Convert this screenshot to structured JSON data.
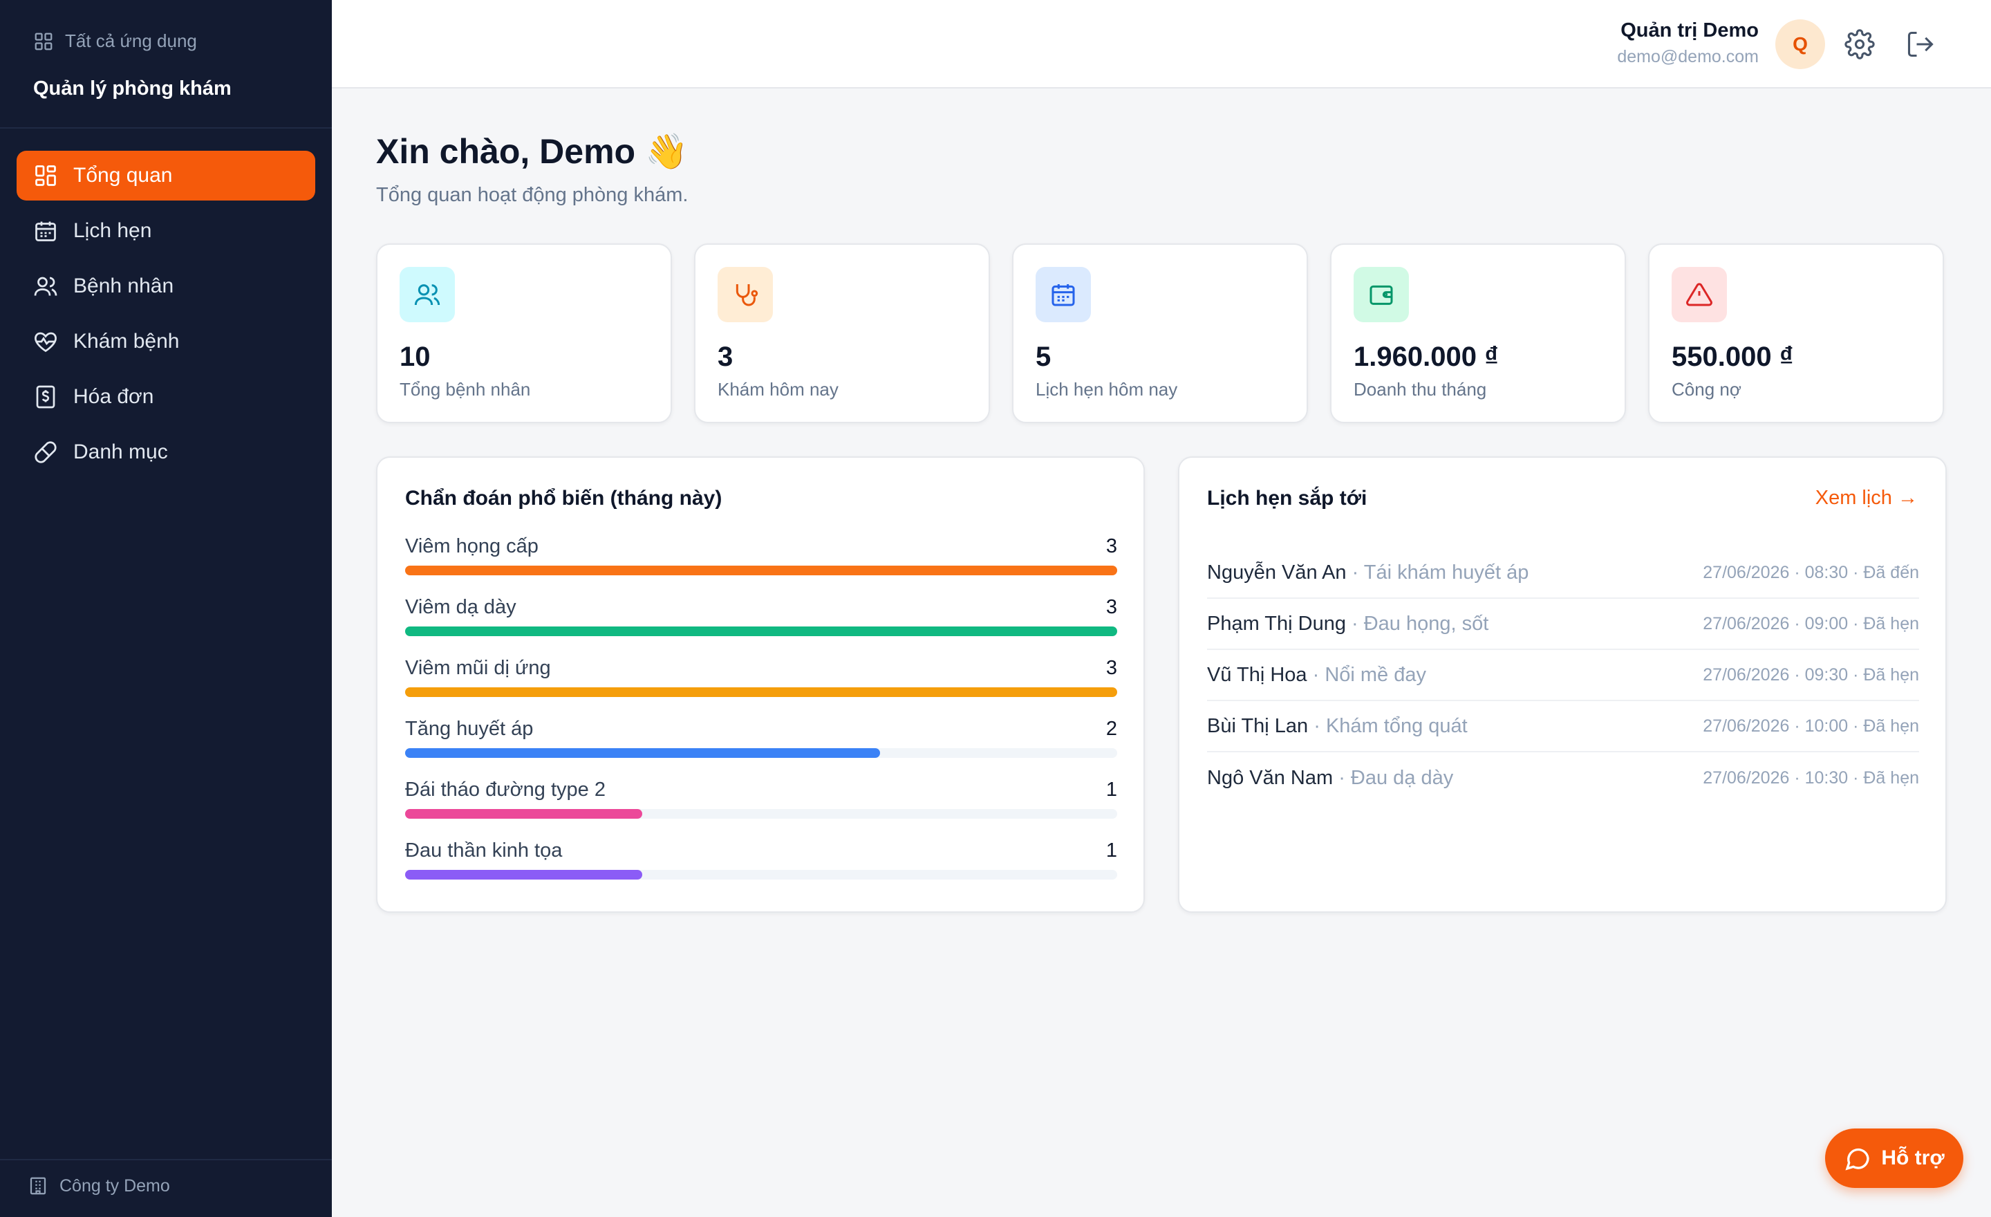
{
  "sidebar": {
    "all_apps_label": "Tất cả ứng dụng",
    "brand": "Quản lý phòng khám",
    "items": [
      {
        "label": "Tổng quan",
        "icon": "dashboard-icon",
        "active": true
      },
      {
        "label": "Lịch hẹn",
        "icon": "calendar-icon"
      },
      {
        "label": "Bệnh nhân",
        "icon": "users-icon"
      },
      {
        "label": "Khám bệnh",
        "icon": "heart-pulse-icon"
      },
      {
        "label": "Hóa đơn",
        "icon": "receipt-icon"
      },
      {
        "label": "Danh mục",
        "icon": "pill-icon"
      }
    ],
    "company": "Công ty Demo"
  },
  "header": {
    "user_name": "Quản trị Demo",
    "user_email": "demo@demo.com",
    "avatar_initial": "Q"
  },
  "greeting": {
    "title": "Xin chào, Demo 👋",
    "subtitle": "Tổng quan hoạt động phòng khám."
  },
  "stats": [
    {
      "value": "10",
      "label": "Tổng bệnh nhân",
      "icon": "users-icon",
      "color": "#0891b2",
      "bg": "#cffafe"
    },
    {
      "value": "3",
      "label": "Khám hôm nay",
      "icon": "stethoscope-icon",
      "color": "#ea580c",
      "bg": "#ffedd5"
    },
    {
      "value": "5",
      "label": "Lịch hẹn hôm nay",
      "icon": "calendar-icon",
      "color": "#2563eb",
      "bg": "#dbeafe"
    },
    {
      "value": "1.960.000 ₫",
      "label": "Doanh thu tháng",
      "icon": "wallet-icon",
      "color": "#059669",
      "bg": "#d1fae5"
    },
    {
      "value": "550.000 ₫",
      "label": "Công nợ",
      "icon": "warning-icon",
      "color": "#dc2626",
      "bg": "#fee2e2"
    }
  ],
  "diagnoses": {
    "title": "Chẩn đoán phổ biến (tháng này)",
    "max": 3,
    "items": [
      {
        "name": "Viêm họng cấp",
        "count": 3,
        "color": "#f97316"
      },
      {
        "name": "Viêm dạ dày",
        "count": 3,
        "color": "#10b981"
      },
      {
        "name": "Viêm mũi dị ứng",
        "count": 3,
        "color": "#f59e0b"
      },
      {
        "name": "Tăng huyết áp",
        "count": 2,
        "color": "#3b82f6"
      },
      {
        "name": "Đái tháo đường type 2",
        "count": 1,
        "color": "#ec4899"
      },
      {
        "name": "Đau thần kinh tọa",
        "count": 1,
        "color": "#8b5cf6"
      }
    ]
  },
  "appointments": {
    "title": "Lịch hẹn sắp tới",
    "link_label": "Xem lịch →",
    "items": [
      {
        "name": "Nguyễn Văn An",
        "note": " · Tái khám huyết áp",
        "time": "27/06/2026 · 08:30 · Đã đến"
      },
      {
        "name": "Phạm Thị Dung",
        "note": " · Đau họng, sốt",
        "time": "27/06/2026 · 09:00 · Đã hẹn"
      },
      {
        "name": "Vũ Thị Hoa",
        "note": " · Nổi mề đay",
        "time": "27/06/2026 · 09:30 · Đã hẹn"
      },
      {
        "name": "Bùi Thị Lan",
        "note": " · Khám tổng quát",
        "time": "27/06/2026 · 10:00 · Đã hẹn"
      },
      {
        "name": "Ngô Văn Nam",
        "note": " · Đau dạ dày",
        "time": "27/06/2026 · 10:30 · Đã hẹn"
      }
    ]
  },
  "help_button": "Hỗ trợ",
  "accent": "#f55a0b"
}
